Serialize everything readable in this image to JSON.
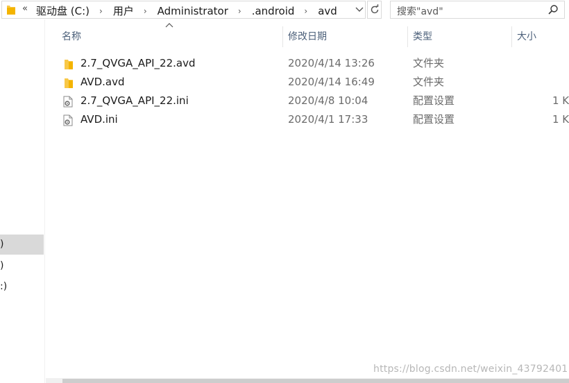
{
  "address_bar": {
    "overflow_glyph": "«",
    "breadcrumbs": [
      {
        "label": "驱动盘 (C:)"
      },
      {
        "label": "用户"
      },
      {
        "label": "Administrator"
      },
      {
        "label": ".android"
      },
      {
        "label": "avd"
      }
    ],
    "separator_glyph": "›"
  },
  "search": {
    "placeholder": "搜索\"avd\""
  },
  "nav_pane": {
    "items": [
      {
        "label": ")",
        "selected": true
      },
      {
        "label": ")",
        "selected": false
      },
      {
        "label": ":)",
        "selected": false
      }
    ]
  },
  "columns": {
    "name": "名称",
    "date": "修改日期",
    "type": "类型",
    "size": "大小"
  },
  "files": [
    {
      "name": "2.7_QVGA_API_22.avd",
      "date": "2020/4/14 13:26",
      "type": "文件夹",
      "size": "",
      "icon": "folder-icon"
    },
    {
      "name": "AVD.avd",
      "date": "2020/4/14 16:49",
      "type": "文件夹",
      "size": "",
      "icon": "folder-icon"
    },
    {
      "name": "2.7_QVGA_API_22.ini",
      "date": "2020/4/8 10:04",
      "type": "配置设置",
      "size": "1 K",
      "icon": "config-file-icon"
    },
    {
      "name": "AVD.ini",
      "date": "2020/4/1 17:33",
      "type": "配置设置",
      "size": "1 K",
      "icon": "config-file-icon"
    }
  ],
  "watermark": "https://blog.csdn.net/weixin_43792401",
  "colors": {
    "folder": "#f8c847",
    "header_text": "#4c607a",
    "selection": "#d9d9d9"
  }
}
